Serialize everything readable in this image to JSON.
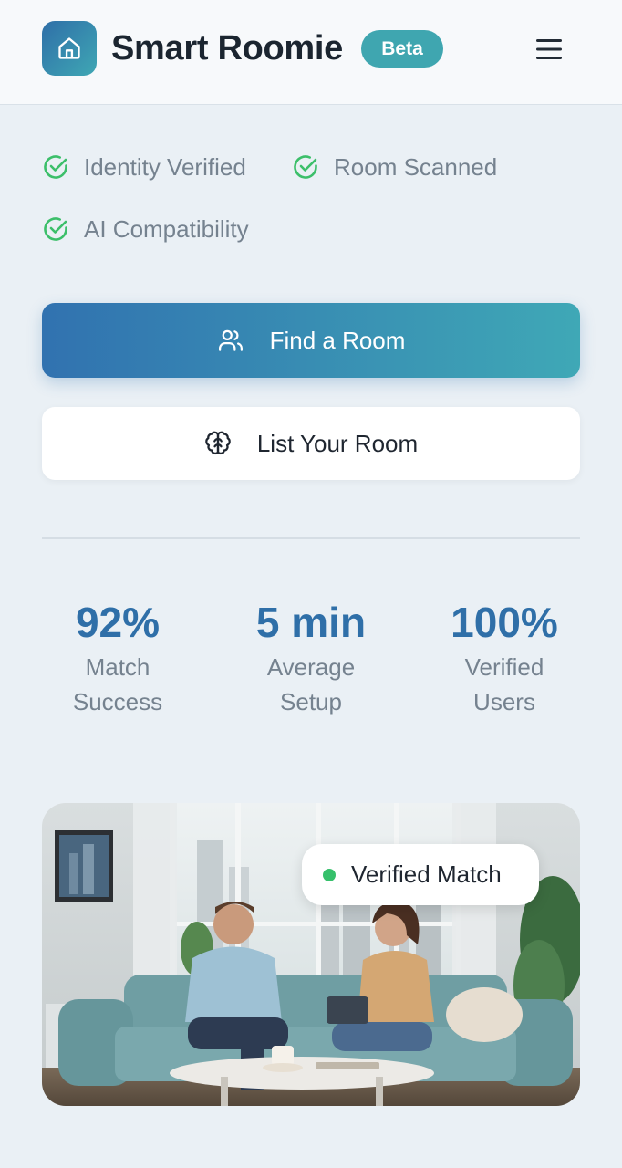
{
  "header": {
    "app_name": "Smart Roomie",
    "badge": "Beta",
    "logo_icon": "home-icon",
    "menu_icon": "hamburger-menu-icon"
  },
  "features": [
    {
      "label": "Identity Verified",
      "icon": "check-circle-icon"
    },
    {
      "label": "Room Scanned",
      "icon": "check-circle-icon"
    },
    {
      "label": "AI Compatibility",
      "icon": "check-circle-icon"
    }
  ],
  "actions": {
    "find_room": {
      "label": "Find a Room",
      "icon": "users-icon"
    },
    "list_room": {
      "label": "List Your Room",
      "icon": "brain-icon"
    }
  },
  "stats": [
    {
      "value": "92%",
      "label_line1": "Match",
      "label_line2": "Success"
    },
    {
      "value": "5 min",
      "label_line1": "Average",
      "label_line2": "Setup"
    },
    {
      "value": "100%",
      "label_line1": "Verified",
      "label_line2": "Users"
    }
  ],
  "hero": {
    "chip_label": "Verified Match"
  },
  "colors": {
    "accent": "#2f6fa8",
    "teal": "#3fa6b0",
    "success": "#36c06b",
    "check": "#3cbf6a"
  }
}
